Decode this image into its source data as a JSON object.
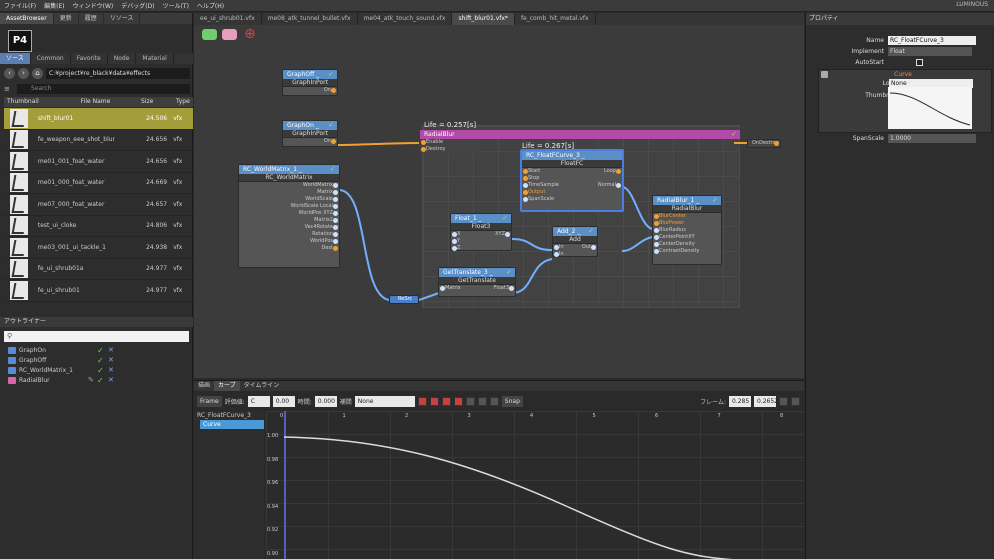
{
  "menubar": {
    "items": [
      "ファイル(F)",
      "編集(E)",
      "ウィンドウ(W)",
      "デバッグ(D)",
      "ツール(T)",
      "ヘルプ(H)"
    ],
    "brand": "LUMINOUS"
  },
  "left_panel": {
    "tabs": [
      "AssetBrowser",
      "更新",
      "履歴",
      "リソース"
    ],
    "logo": "P4",
    "subtabs": [
      "ソース",
      "Common",
      "Favorite",
      "Node",
      "Material"
    ],
    "path": "C:¥project¥re_black¥data¥effects",
    "search_placeholder": "Search",
    "columns": [
      "Thumbnail",
      "File Name",
      "Size",
      "Type"
    ],
    "files": [
      {
        "name": "shift_blur01",
        "size": "24.506",
        "type": "vfx",
        "selected": true
      },
      {
        "name": "fe_weapon_eee_shot_blur",
        "size": "24.656",
        "type": "vfx",
        "selected": false
      },
      {
        "name": "me01_001_foat_water",
        "size": "24.656",
        "type": "vfx",
        "selected": false
      },
      {
        "name": "me01_000_foat_water",
        "size": "24.669",
        "type": "vfx",
        "selected": false
      },
      {
        "name": "me07_000_foat_water",
        "size": "24.657",
        "type": "vfx",
        "selected": false
      },
      {
        "name": "test_ui_cloke",
        "size": "24.806",
        "type": "vfx",
        "selected": false
      },
      {
        "name": "me03_001_ui_tackle_1",
        "size": "24.938",
        "type": "vfx",
        "selected": false
      },
      {
        "name": "fe_ui_shrub01a",
        "size": "24.977",
        "type": "vfx",
        "selected": false
      },
      {
        "name": "fe_ui_shrub01",
        "size": "24.977",
        "type": "vfx",
        "selected": false
      }
    ],
    "outliner_title": "アウトライナー",
    "outliner_items": [
      {
        "name": "GraphOn",
        "color": "blue"
      },
      {
        "name": "GraphOff",
        "color": "blue"
      },
      {
        "name": "RC_WorldMatrix_1",
        "color": "blue"
      },
      {
        "name": "RadialBlur",
        "color": "pink"
      }
    ]
  },
  "graph": {
    "tabs": [
      "ee_ui_shrub01.vfx",
      "me08_atk_tunnel_bullet.vfx",
      "me04_atk_touch_sound.vfx",
      "shift_blur01.vfx*",
      "fe_comb_hit_metal.vfx"
    ],
    "active_tab": 3,
    "life_outer": "Life = 0.257[s]",
    "life_inner": "Life = 0.267[s]",
    "nodes": {
      "graphoff": {
        "title": "GraphOff _",
        "sub": "GraphInPort",
        "rows": [
          "On"
        ]
      },
      "graphon": {
        "title": "GraphOn _",
        "sub": "GraphInPort",
        "rows": [
          "On"
        ]
      },
      "radialblur_main": {
        "title": "RadialBlur",
        "in_rows": [
          "Enable",
          "Destroy"
        ],
        "out": "OnDestroy"
      },
      "rc_world": {
        "title": "RC_WorldMatrix_1 _",
        "sub": "RC_WorldMatrix",
        "rows": [
          "WorldMatrix",
          "Matrix",
          "WorldScale",
          "WorldScale Local",
          "WorldPos XYZ",
          "Matrix2",
          "Vec4Rotate",
          "Rotation",
          "WorldPos",
          "Dest"
        ]
      },
      "fcurve": {
        "title": "RC_FloatFCurve_3 _",
        "sub": "FloatFC",
        "rows_in": [
          "Start",
          "Stop",
          "TimeSample",
          "Output",
          "SpanScale"
        ],
        "rows_out": [
          "Loop",
          "Normal"
        ]
      },
      "float": {
        "title": "Float_1 _",
        "sub": "Float3",
        "rows_in": [
          "X",
          "Y",
          "Z"
        ],
        "rows_out": [
          "XYZ"
        ]
      },
      "add": {
        "title": "Add_2 _",
        "sub": "Add",
        "rows_in": [
          "In",
          "In"
        ],
        "rows_out": [
          "Out"
        ]
      },
      "radialblur_node": {
        "title": "RadialBlur_1 _",
        "sub": "RadialBlur",
        "rows": [
          "BlurCenter",
          "BlurPower",
          "BlurRadius",
          "CenterPointXY",
          "CenterDensity",
          "ContrastDensity"
        ]
      },
      "gettranslate": {
        "title": "GetTranslate_3 _",
        "sub": "GetTranslate",
        "rows_in": [
          "Matrix"
        ],
        "rows_out": [
          "Float3"
        ]
      },
      "reroute": {
        "label": "ReSrc"
      }
    }
  },
  "curve": {
    "tabs": [
      "描画",
      "カーブ",
      "タイムライン"
    ],
    "frame_label": "Frame",
    "field_label_1": "評価値:",
    "field_val_1": "C",
    "field_val_2": "0.00",
    "field_label_2": "時間:",
    "field_val_3": "0.000",
    "field_label_3": "補間",
    "interp": "None",
    "snap_label": "Snap",
    "frame_label_right": "フレーム:",
    "frame_val_1": "0.285",
    "frame_val_2": "0.2652",
    "tree_root": "RC_FloatFCurve_3",
    "tree_child": "Curve",
    "x_ticks": [
      "0",
      "1",
      "2",
      "3",
      "4",
      "5",
      "6",
      "7",
      "8"
    ],
    "y_ticks": [
      "1.00",
      "0.98",
      "0.96",
      "0.94",
      "0.92",
      "0.90"
    ]
  },
  "properties": {
    "title": "プロパティ",
    "name_label": "Name",
    "name_value": "RC_FloatFCurve_3",
    "implement_label": "Implement",
    "implement_value": "Float",
    "autostart_label": "AutoStart",
    "curve_label": "Curve",
    "loop_label": "Loop",
    "loop_value": "None",
    "thumbnail_label": "Thumbnail",
    "spanscale_label": "SpanScale",
    "spanscale_value": "1.0000"
  }
}
